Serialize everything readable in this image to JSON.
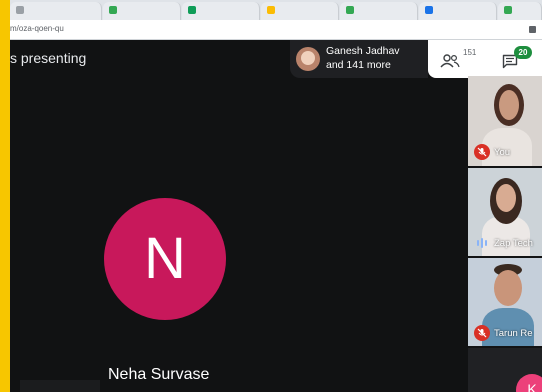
{
  "browser": {
    "url": "m/oza-qoen-qu"
  },
  "meeting": {
    "presenting_text": "s presenting",
    "main_tile": {
      "initial": "N",
      "name": "Neha Survase",
      "avatar_color": "#c8185b"
    },
    "participants_pill": {
      "line1": "Ganesh Jadhav",
      "line2": "and 141 more"
    },
    "controls": {
      "people_count": "151",
      "chat_count": "20"
    },
    "side_tiles": [
      {
        "label": "You",
        "muted": true
      },
      {
        "label": "Zap Tech",
        "speaking": true
      },
      {
        "label": "Tarun Re",
        "muted": true
      },
      {
        "initial": "K"
      }
    ]
  },
  "colors": {
    "frame": "#f7c600",
    "muted_red": "#d93025",
    "chat_badge": "#1e8e3e"
  }
}
